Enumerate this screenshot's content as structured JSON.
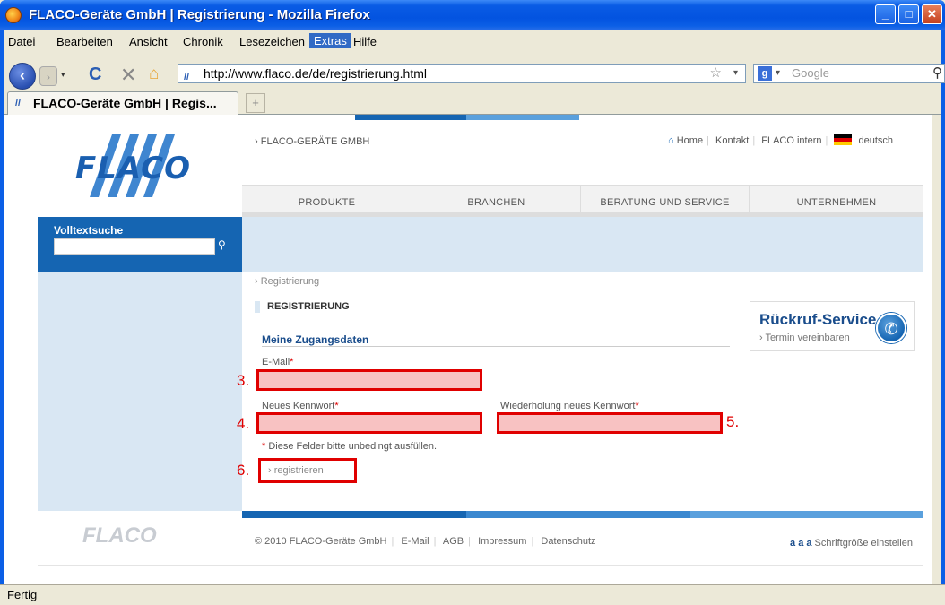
{
  "window": {
    "title": "FLACO-Geräte GmbH | Registrierung - Mozilla Firefox",
    "min": "_",
    "max": "□",
    "close": "✕"
  },
  "menu": [
    "Datei",
    "Bearbeiten",
    "Ansicht",
    "Chronik",
    "Lesezeichen",
    "Extras",
    "Hilfe"
  ],
  "nav": {
    "url": "http://www.flaco.de/de/registrierung.html",
    "search_placeholder": "Google"
  },
  "tab": {
    "label": "FLACO-Geräte GmbH | Regis...",
    "new_tab": "+"
  },
  "sidebar": {
    "logo": "FLACO",
    "search_label": "Volltextsuche",
    "footer_logo": "FLACO"
  },
  "header": {
    "breadcrumb": "FLACO-GERÄTE GMBH",
    "links": [
      "Home",
      "Kontakt",
      "FLACO intern",
      "deutsch"
    ]
  },
  "nav_tabs": [
    "PRODUKTE",
    "BRANCHEN",
    "BERATUNG UND SERVICE",
    "UNTERNEHMEN"
  ],
  "content": {
    "breadcrumb": "Registrierung",
    "heading": "REGISTRIERUNG",
    "subheading": "Meine Zugangsdaten",
    "fields": {
      "email_label": "E-Mail",
      "password_label": "Neues Kennwort",
      "password_repeat_label": "Wiederholung neues Kennwort",
      "required_mark": "*"
    },
    "annotations": {
      "email": "3.",
      "password": "4.",
      "password_repeat": "5.",
      "submit": "6."
    },
    "hint": "Diese Felder bitte unbedingt ausfüllen.",
    "submit_label": "registrieren"
  },
  "callback": {
    "title": "Rückruf-Service",
    "link": "Termin vereinbaren"
  },
  "footer": {
    "copyright": "© 2010 FLACO-Geräte GmbH",
    "links": [
      "E-Mail",
      "AGB",
      "Impressum",
      "Datenschutz"
    ],
    "fontsize_glyphs": "a a a",
    "fontsize_label": "Schriftgröße einstellen"
  },
  "status": "Fertig",
  "colors": {
    "accent": "#1565b2",
    "light_blue": "#d9e7f3",
    "highlight_red": "#e00000"
  }
}
